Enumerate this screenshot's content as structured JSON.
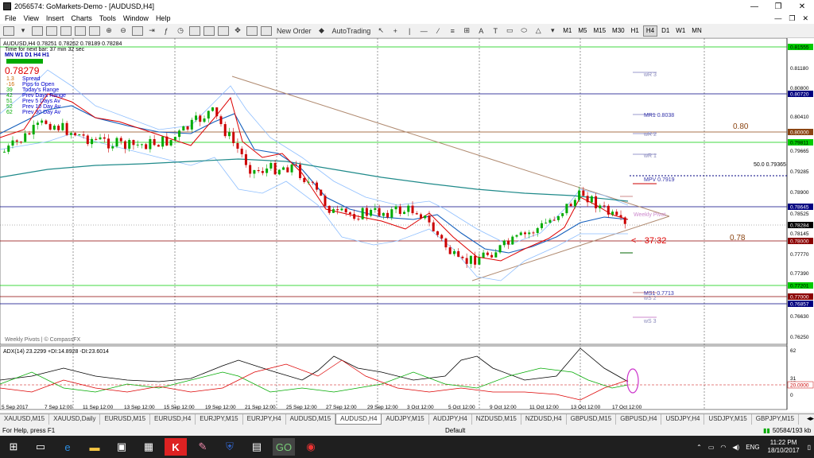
{
  "window": {
    "title": "2056574: GoMarkets-Demo - [AUDUSD,H4]"
  },
  "menu": [
    "File",
    "View",
    "Insert",
    "Charts",
    "Tools",
    "Window",
    "Help"
  ],
  "toolbar": {
    "new_order": "New Order",
    "autotrading": "AutoTrading"
  },
  "timeframes": [
    "M1",
    "M5",
    "M15",
    "M30",
    "H1",
    "H4",
    "D1",
    "W1",
    "MN"
  ],
  "chart": {
    "symbol_line": "AUDUSD,H4  0.78251  0.78262  0.78189  0.78284",
    "timer_line": "Time for next bar: 37 min 32 sec",
    "tf_row": "MN W1 D1 H4 H1",
    "price_big": "0.78279",
    "stats": [
      {
        "value": "1.3",
        "label": "Spread"
      },
      {
        "value": "-16",
        "label": "Pips to Open"
      },
      {
        "value": "39",
        "label": "Today's Range"
      },
      {
        "value": "42",
        "label": "Prev Days Range"
      },
      {
        "value": "51",
        "label": "Prev 5 Days Av"
      },
      {
        "value": "52",
        "label": "Prev 10 Day Av"
      },
      {
        "value": "62",
        "label": "Prev 30 Day Av"
      }
    ],
    "pivot_labels": {
      "wr3": "wR 3",
      "mr1": "MR1  0.8038",
      "wr2": "wR 2",
      "wr1": "wR 1",
      "fib": "50.0  0.79365",
      "mpv": "MPV  0.7919",
      "weekly_pivot": "Weekly Pivot",
      "countdown": "<-- 37:32",
      "ms1": "MS1  0.7713",
      "ws2": "wS 2",
      "ws3": "wS 3"
    },
    "level_notes": {
      "l080": "0.80",
      "l078": "0.78"
    },
    "price_axis": [
      "0.81555",
      "0.81180",
      "0.80800",
      "0.80720",
      "0.80410",
      "0.80000",
      "0.79811",
      "0.79665",
      "0.79285",
      "0.78900",
      "0.78645",
      "0.78525",
      "0.78284",
      "0.78145",
      "0.78000",
      "0.77770",
      "0.77390",
      "0.77201",
      "0.77000",
      "0.76857",
      "0.76630",
      "0.76250"
    ],
    "time_axis": [
      "5 Sep 2017",
      "7 Sep 12:00",
      "11 Sep 12:00",
      "13 Sep 12:00",
      "15 Sep 12:00",
      "19 Sep 12:00",
      "21 Sep 12:00",
      "25 Sep 12:00",
      "27 Sep 12:00",
      "29 Sep 12:00",
      "3 Oct 12:00",
      "5 Oct 12:00",
      "9 Oct 12:00",
      "11 Oct 12:00",
      "13 Oct 12:00",
      "17 Oct 12:00"
    ],
    "watermark": "Weekly Pivots | © CompassFX",
    "adx_label": "ADX(14) 23.2299 +DI:14.8928 -DI:23.6014",
    "adx_axis": [
      "62",
      "31",
      "25",
      "20.0000",
      "0"
    ]
  },
  "chart_data": {
    "type": "line",
    "title": "AUDUSD,H4",
    "x": [
      "5 Sep 2017",
      "7 Sep 12:00",
      "11 Sep 12:00",
      "13 Sep 12:00",
      "15 Sep 12:00",
      "19 Sep 12:00",
      "21 Sep 12:00",
      "25 Sep 12:00",
      "27 Sep 12:00",
      "29 Sep 12:00",
      "3 Oct 12:00",
      "5 Oct 12:00",
      "9 Oct 12:00",
      "11 Oct 12:00",
      "13 Oct 12:00",
      "17 Oct 12:00"
    ],
    "series": [
      {
        "name": "AUDUSD",
        "values": [
          0.7965,
          0.802,
          0.799,
          0.7975,
          0.7985,
          0.804,
          0.793,
          0.794,
          0.785,
          0.7855,
          0.786,
          0.776,
          0.779,
          0.783,
          0.789,
          0.7828
        ]
      }
    ],
    "ylim": [
      0.7625,
      0.8156
    ]
  },
  "tabs": [
    "XAUUSD,M15",
    "XAUUSD,Daily",
    "EURUSD,M15",
    "EURUSD,H4",
    "EURJPY,M15",
    "EURJPY,H4",
    "AUDUSD,M15",
    "AUDUSD,H4",
    "AUDJPY,M15",
    "AUDJPY,H4",
    "NZDUSD,M15",
    "NZDUSD,H4",
    "GBPUSD,M15",
    "GBPUSD,H4",
    "USDJPY,H4",
    "USDJPY,M15",
    "GBPJPY,M15"
  ],
  "active_tab": "AUDUSD,H4",
  "status": {
    "help": "For Help, press F1",
    "profile": "Default",
    "traffic": "50584/193 kb"
  },
  "taskbar": {
    "lang": "ENG",
    "time": "11:22 PM",
    "date": "18/10/2017"
  },
  "colors": {
    "candle_up": "#00aa00",
    "candle_down": "#cc0000",
    "ma_blue": "#1560bd",
    "ma_teal": "#1f8a8a",
    "ma_red": "#dd0000",
    "band": "#8fbfff",
    "trend": "#b08a70",
    "level_green": "#00cc00",
    "level_navy": "#000080",
    "level_brown": "#8b0000"
  }
}
